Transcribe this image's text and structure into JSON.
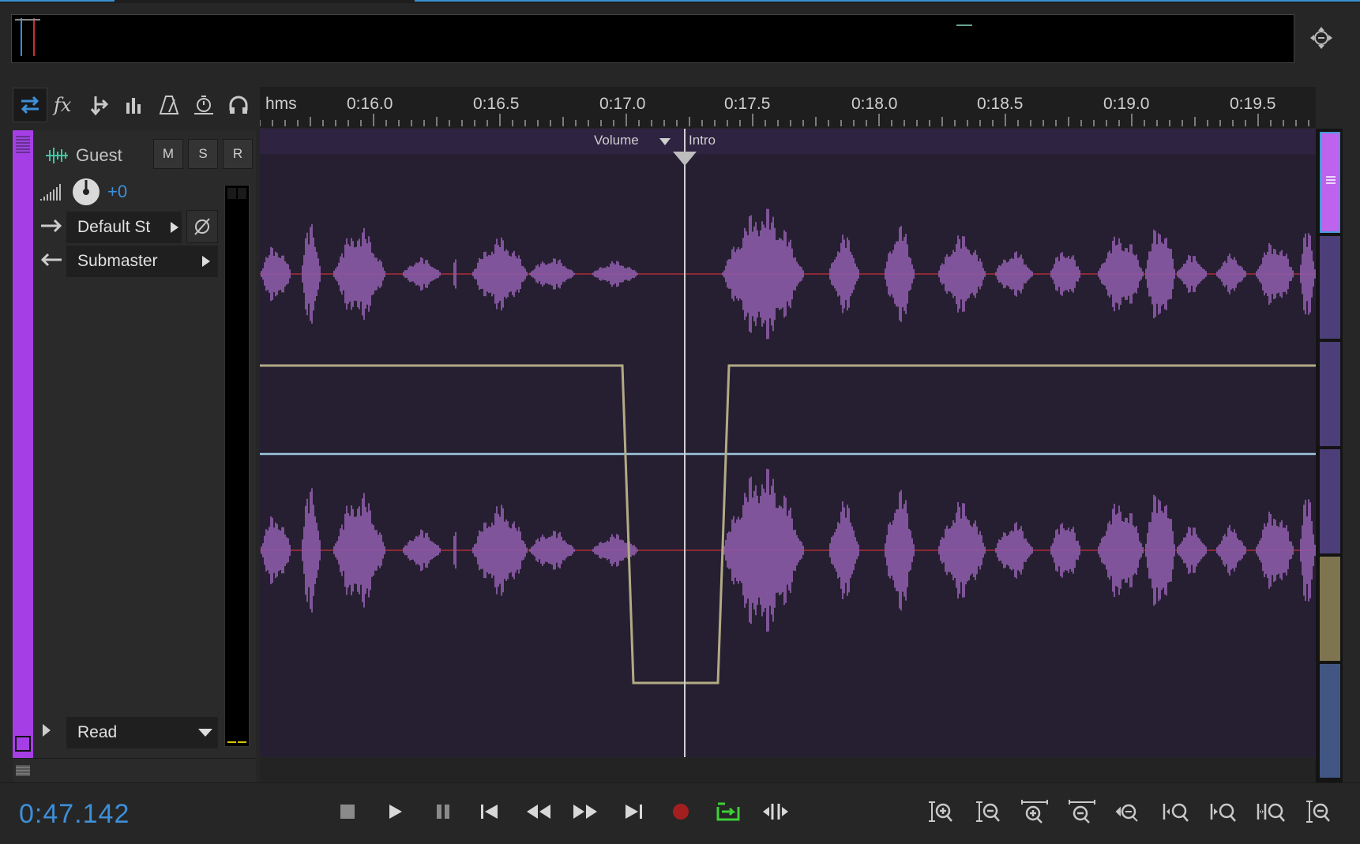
{
  "colors": {
    "accent": "#3d8fd8",
    "track_color": "#a63ee6",
    "waveform": "#8a5aa6",
    "envelope_volume": "#b2ab85",
    "envelope_pan": "#9cc6df",
    "center_line": "#c8303a",
    "record": "#a31f1f",
    "loop_active": "#3ecf36"
  },
  "track_toolbar": {
    "buttons": [
      {
        "icon": "inputs-outputs-icon",
        "active": true
      },
      {
        "icon": "effects-fx-icon"
      },
      {
        "icon": "sends-icon"
      },
      {
        "icon": "eq-icon"
      },
      {
        "icon": "metronome-icon"
      },
      {
        "icon": "time-selection-icon"
      },
      {
        "icon": "headphones-icon"
      }
    ]
  },
  "track": {
    "name": "Guest",
    "mute_label": "M",
    "solo_label": "S",
    "record_label": "R",
    "volume_value": "+0",
    "input_label": "Default St",
    "output_label": "Submaster",
    "automation_mode": "Read"
  },
  "ruler": {
    "unit_label": "hms",
    "labels": [
      "0:16.0",
      "0:16.5",
      "0:17.0",
      "0:17.5",
      "0:18.0",
      "0:18.5",
      "0:19.0",
      "0:19.5"
    ]
  },
  "clip": {
    "envelope_dropdown_label": "Volume",
    "clip_name": "Intro"
  },
  "transport": {
    "current_time": "0:47.142",
    "buttons": [
      "stop-icon",
      "play-icon",
      "pause-icon",
      "go-to-start-icon",
      "rewind-icon",
      "fast-forward-icon",
      "go-to-end-icon",
      "record-icon",
      "loop-playback-icon",
      "skip-selection-icon"
    ]
  },
  "zoom_controls": [
    "zoom-in-amplitude-icon",
    "zoom-out-amplitude-icon",
    "zoom-in-time-icon",
    "zoom-out-time-icon",
    "zoom-out-full-icon",
    "zoom-in-at-start-icon",
    "zoom-in-at-end-icon",
    "zoom-selection-icon",
    "zoom-all-tracks-icon"
  ]
}
